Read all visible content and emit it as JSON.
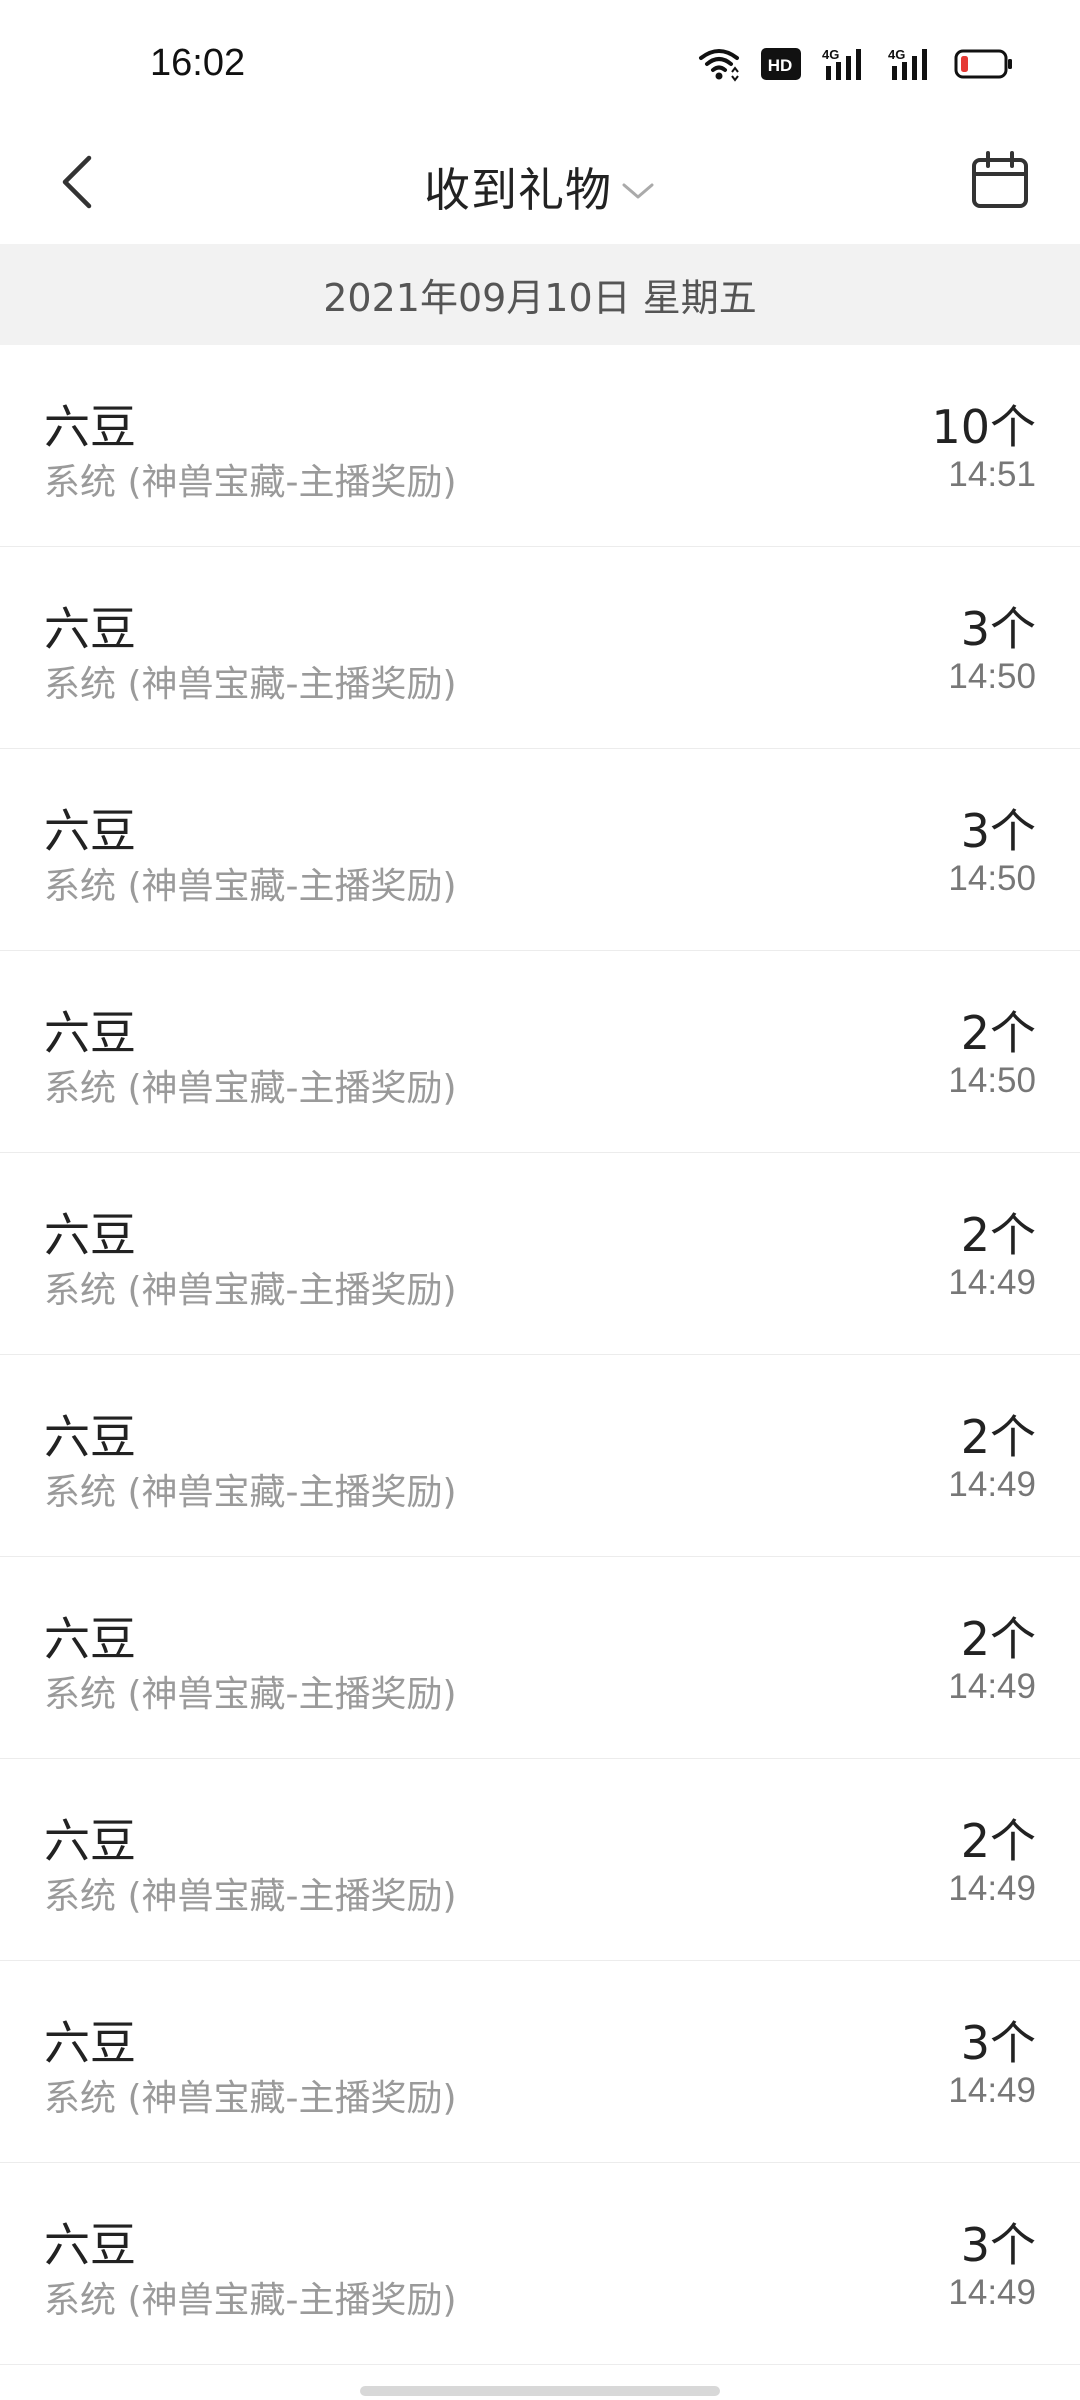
{
  "status_bar": {
    "time": "16:02",
    "icons": [
      "wifi-icon",
      "hd-icon",
      "signal-4g-icon",
      "signal-4g-icon",
      "battery-low-icon"
    ],
    "hd_label": "HD",
    "network_label_1": "4G",
    "network_label_2": "4G",
    "battery_color": "#e53935"
  },
  "header": {
    "title": "收到礼物",
    "back_icon": "chevron-left-icon",
    "dropdown_icon": "chevron-down-icon",
    "calendar_icon": "calendar-icon"
  },
  "date_section": {
    "label": "2021年09月10日 星期五"
  },
  "gifts": [
    {
      "name": "六豆",
      "source": "系统 (神兽宝藏-主播奖励)",
      "count": "10个",
      "time": "14:51"
    },
    {
      "name": "六豆",
      "source": "系统 (神兽宝藏-主播奖励)",
      "count": "3个",
      "time": "14:50"
    },
    {
      "name": "六豆",
      "source": "系统 (神兽宝藏-主播奖励)",
      "count": "3个",
      "time": "14:50"
    },
    {
      "name": "六豆",
      "source": "系统 (神兽宝藏-主播奖励)",
      "count": "2个",
      "time": "14:50"
    },
    {
      "name": "六豆",
      "source": "系统 (神兽宝藏-主播奖励)",
      "count": "2个",
      "time": "14:49"
    },
    {
      "name": "六豆",
      "source": "系统 (神兽宝藏-主播奖励)",
      "count": "2个",
      "time": "14:49"
    },
    {
      "name": "六豆",
      "source": "系统 (神兽宝藏-主播奖励)",
      "count": "2个",
      "time": "14:49"
    },
    {
      "name": "六豆",
      "source": "系统 (神兽宝藏-主播奖励)",
      "count": "2个",
      "time": "14:49"
    },
    {
      "name": "六豆",
      "source": "系统 (神兽宝藏-主播奖励)",
      "count": "3个",
      "time": "14:49"
    },
    {
      "name": "六豆",
      "source": "系统 (神兽宝藏-主播奖励)",
      "count": "3个",
      "time": "14:49"
    }
  ]
}
